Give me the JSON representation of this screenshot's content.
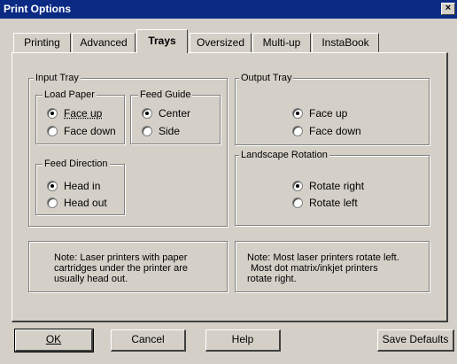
{
  "window": {
    "title": "Print Options",
    "close_glyph": "×",
    "close_icon": "close-icon"
  },
  "tabs": [
    {
      "label": "Printing",
      "active": false
    },
    {
      "label": "Advanced",
      "active": false
    },
    {
      "label": "Trays",
      "active": true
    },
    {
      "label": "Oversized",
      "active": false
    },
    {
      "label": "Multi-up",
      "active": false
    },
    {
      "label": "InstaBook",
      "active": false
    }
  ],
  "input_tray": {
    "title": "Input Tray",
    "load_paper": {
      "title": "Load Paper",
      "options": [
        {
          "label": "Face up",
          "checked": true
        },
        {
          "label": "Face down",
          "checked": false
        }
      ]
    },
    "feed_guide": {
      "title": "Feed Guide",
      "options": [
        {
          "label": "Center",
          "checked": true
        },
        {
          "label": "Side",
          "checked": false
        }
      ]
    },
    "feed_direction": {
      "title": "Feed Direction",
      "options": [
        {
          "label": "Head in",
          "checked": true
        },
        {
          "label": "Head out",
          "checked": false
        }
      ]
    }
  },
  "output_tray": {
    "title": "Output Tray",
    "options": [
      {
        "label": "Face up",
        "checked": true
      },
      {
        "label": "Face down",
        "checked": false
      }
    ]
  },
  "landscape_rotation": {
    "title": "Landscape Rotation",
    "options": [
      {
        "label": "Rotate right",
        "checked": true
      },
      {
        "label": "Rotate left",
        "checked": false
      }
    ]
  },
  "notes": {
    "left": [
      "Note: Laser printers with paper",
      "cartridges under the printer are",
      "usually head out."
    ],
    "right": [
      "Note: Most laser printers rotate left.",
      "Most dot matrix/inkjet printers",
      "rotate right."
    ]
  },
  "buttons": {
    "ok": "OK",
    "cancel": "Cancel",
    "help": "Help",
    "save_defaults": "Save Defaults"
  },
  "colors": {
    "title_bar": "#0a2a84",
    "face": "#d4d0c8"
  }
}
